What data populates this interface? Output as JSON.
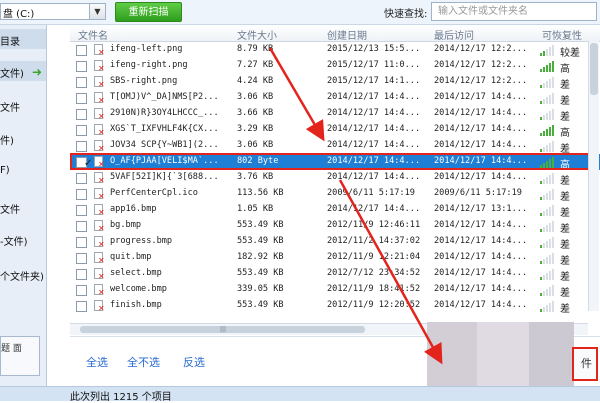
{
  "toolbar": {
    "drive_label": "盘 (C:)",
    "rescan_label": "重新扫描",
    "quick_search_label": "快速查找:",
    "search_placeholder": "输入文件或文件夹名"
  },
  "sidebar": {
    "items": [
      "目录",
      "文件)",
      "文件",
      "件)",
      "F)",
      "文件",
      "-文件)",
      "个文件夹)"
    ],
    "bottom_button": "题 面"
  },
  "table": {
    "columns": [
      "文件名",
      "文件大小",
      "创建日期",
      "最后访问",
      "可恢复性"
    ],
    "rows": [
      {
        "name": "ifeng-left.png",
        "size": "8.79 KB",
        "created": "2015/12/13 15:5...",
        "accessed": "2014/12/17 12:2...",
        "level": "较差",
        "bars": 2
      },
      {
        "name": "ifeng-right.png",
        "size": "7.27 KB",
        "created": "2015/12/17 11:0...",
        "accessed": "2014/12/17 12:2...",
        "level": "高",
        "bars": 5
      },
      {
        "name": "SBS-right.png",
        "size": "4.24 KB",
        "created": "2015/12/17 14:1...",
        "accessed": "2014/12/17 12:2...",
        "level": "差",
        "bars": 1
      },
      {
        "name": "T[OMJ)V^_DA]NMS[P2...",
        "size": "3.06 KB",
        "created": "2014/12/17 14:4...",
        "accessed": "2014/12/17 14:4...",
        "level": "差",
        "bars": 1
      },
      {
        "name": "2910N)R}3OY4LHCCC_...",
        "size": "3.66 KB",
        "created": "2014/12/17 14:4...",
        "accessed": "2014/12/17 14:4...",
        "level": "差",
        "bars": 1
      },
      {
        "name": "XGS`T_IXFVHLF4K{CX...",
        "size": "3.29 KB",
        "created": "2014/12/17 14:4...",
        "accessed": "2014/12/17 14:4...",
        "level": "高",
        "bars": 5
      },
      {
        "name": "JOV34 SCP{Y~WB1](2...",
        "size": "3.06 KB",
        "created": "2014/12/17 14:4...",
        "accessed": "2014/12/17 14:4...",
        "level": "差",
        "bars": 1
      },
      {
        "name": "O_AF{PJAA[VELI$MA`...",
        "size": "802 Byte",
        "created": "2014/12/17 14:4...",
        "accessed": "2014/12/17 14:4...",
        "level": "高",
        "bars": 5,
        "selected": true
      },
      {
        "name": "5VAF[52I]K]{`3[688...",
        "size": "3.76 KB",
        "created": "2014/12/17 14:4...",
        "accessed": "2014/12/17 14:4...",
        "level": "差",
        "bars": 1
      },
      {
        "name": "PerfCenterCpl.ico",
        "size": "113.56 KB",
        "created": "2009/6/11 5:17:19",
        "accessed": "2009/6/11 5:17:19",
        "level": "差",
        "bars": 1
      },
      {
        "name": "app16.bmp",
        "size": "1.05 KB",
        "created": "2014/12/17 14:4...",
        "accessed": "2014/12/17 13:1...",
        "level": "差",
        "bars": 1
      },
      {
        "name": "bg.bmp",
        "size": "553.49 KB",
        "created": "2012/11/9 12:46:11",
        "accessed": "2014/12/17 14:4...",
        "level": "差",
        "bars": 1
      },
      {
        "name": "progress.bmp",
        "size": "553.49 KB",
        "created": "2012/11/2 14:37:02",
        "accessed": "2014/12/17 14:4...",
        "level": "差",
        "bars": 1
      },
      {
        "name": "quit.bmp",
        "size": "182.92 KB",
        "created": "2012/11/9 12:21:04",
        "accessed": "2014/12/17 14:4...",
        "level": "差",
        "bars": 1
      },
      {
        "name": "select.bmp",
        "size": "553.49 KB",
        "created": "2012/7/12 23:34:52",
        "accessed": "2014/12/17 14:4...",
        "level": "差",
        "bars": 1
      },
      {
        "name": "welcome.bmp",
        "size": "339.05 KB",
        "created": "2012/11/9 18:41:52",
        "accessed": "2014/12/17 14:4...",
        "level": "差",
        "bars": 1
      },
      {
        "name": "finish.bmp",
        "size": "553.49 KB",
        "created": "2012/11/9 12:20:52",
        "accessed": "2014/12/17 14:4...",
        "level": "差",
        "bars": 1
      }
    ]
  },
  "actions": {
    "select_all": "全选",
    "select_none": "全不选",
    "invert": "反选",
    "action_button": "件"
  },
  "status": {
    "text": "此次列出 1215 个项目"
  },
  "colors": {
    "accent": "#1f7fd4",
    "annotation": "#e3241c",
    "good_signal": "#47b03a"
  }
}
